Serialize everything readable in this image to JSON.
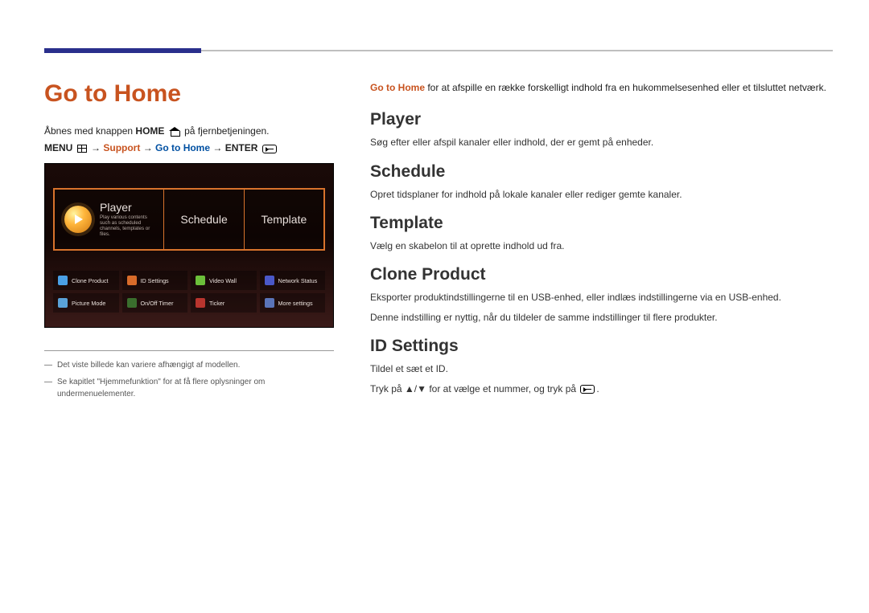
{
  "top": {
    "title": "Go to Home",
    "open_pre": "Åbnes med knappen ",
    "open_bold": "HOME",
    "open_post": " på fjernbetjeningen.",
    "menupath": {
      "menu": "MENU",
      "arrow": " → ",
      "support": "Support",
      "gohome": "Go to Home",
      "enter": "ENTER"
    }
  },
  "tv": {
    "player": "Player",
    "player_sub": "Play various contents such as scheduled channels, templates or files.",
    "schedule": "Schedule",
    "template": "Template",
    "items": [
      "Clone Product",
      "ID Settings",
      "Video Wall",
      "Network Status",
      "Picture Mode",
      "On/Off Timer",
      "Ticker",
      "More settings"
    ]
  },
  "footnotes": [
    "Det viste billede kan variere afhængigt af modellen.",
    "Se kapitlet \"Hjemmefunktion\" for at få flere oplysninger om undermenuelementer."
  ],
  "right": {
    "intro_lead": "Go to Home",
    "intro_rest": " for at afspille en række forskelligt indhold fra en hukommelsesenhed eller et tilsluttet netværk.",
    "sections": {
      "player": {
        "h": "Player",
        "d": "Søg efter eller afspil kanaler eller indhold, der er gemt på enheder."
      },
      "schedule": {
        "h": "Schedule",
        "d": "Opret tidsplaner for indhold på lokale kanaler eller rediger gemte kanaler."
      },
      "template": {
        "h": "Template",
        "d": "Vælg en skabelon til at oprette indhold ud fra."
      },
      "clone": {
        "h": "Clone Product",
        "d1": "Eksporter produktindstillingerne til en USB-enhed, eller indlæs indstillingerne via en USB-enhed.",
        "d2": "Denne indstilling er nyttig, når du tildeler de samme indstillinger til flere produkter."
      },
      "id": {
        "h": "ID Settings",
        "d1": "Tildel et sæt et ID.",
        "d2_pre": "Tryk på ",
        "d2_arrows": "▲/▼",
        "d2_mid": " for at vælge et nummer, og tryk på ",
        "d2_post": "."
      }
    }
  }
}
